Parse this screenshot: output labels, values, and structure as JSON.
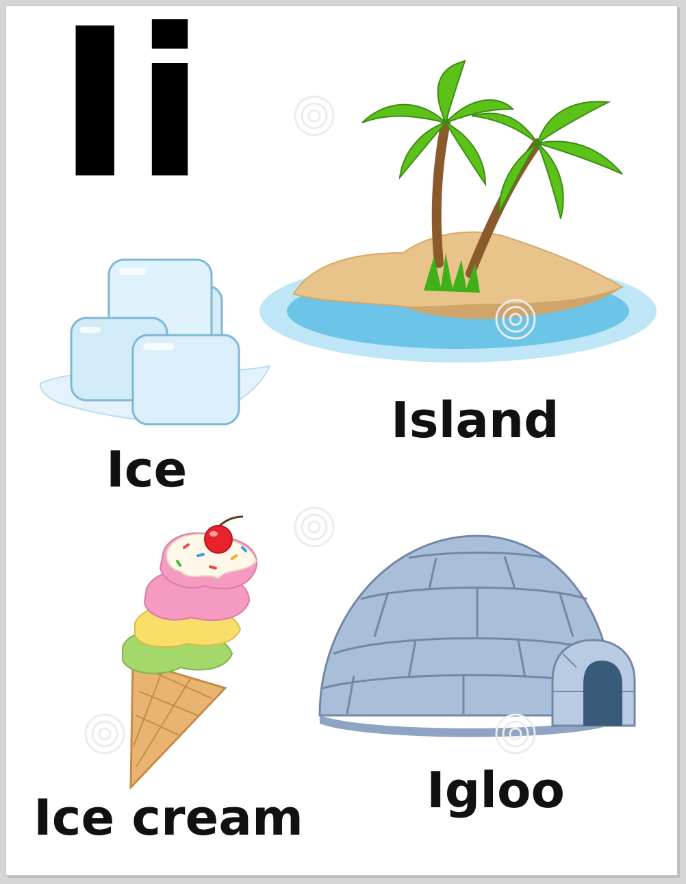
{
  "heading": {
    "letters": "Ii"
  },
  "items": {
    "island": {
      "label": "Island",
      "icon": "island-palm-trees"
    },
    "ice": {
      "label": "Ice",
      "icon": "ice-cubes"
    },
    "ice_cream": {
      "label": "Ice cream",
      "icon": "ice-cream-cone"
    },
    "igloo": {
      "label": "Igloo",
      "icon": "igloo"
    }
  },
  "watermark": {
    "brand": "dreamstime",
    "icon": "spiral-logo"
  },
  "colors": {
    "page_bg": "#ffffff",
    "text": "#111111",
    "sand": "#e8c48a",
    "water": "#6cc4e8",
    "palm_leaf": "#5cc21a",
    "ice": "#cfeaf8",
    "igloo": "#9fb4d0"
  }
}
